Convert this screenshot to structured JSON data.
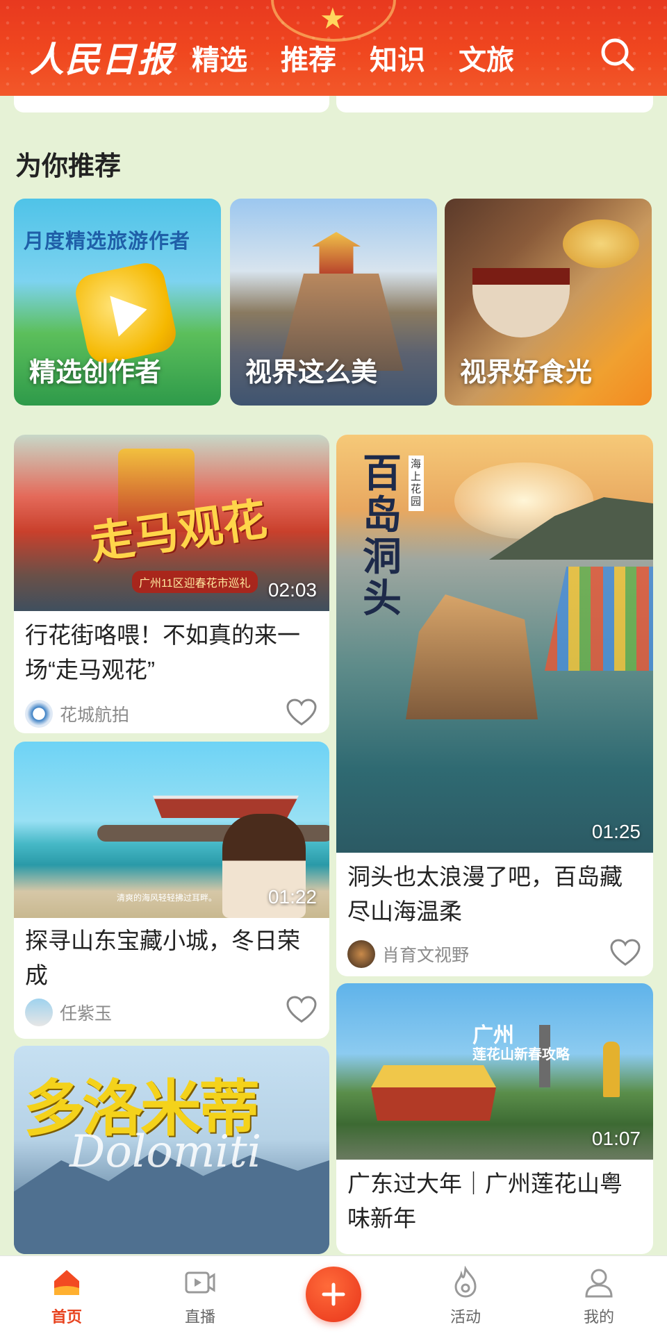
{
  "header": {
    "logo": "人民日报",
    "tabs": [
      "精选",
      "推荐",
      "知识",
      "文旅"
    ]
  },
  "section": {
    "title": "为你推荐"
  },
  "categories": [
    {
      "label": "精选创作者",
      "banner": "月度精选旅游作者"
    },
    {
      "label": "视界这么美"
    },
    {
      "label": "视界好食光"
    }
  ],
  "videos": [
    {
      "title": "行花街咯喂！不如真的来一场“走马观花”",
      "author": "花城航拍",
      "duration": "02:03",
      "overlay": "走马观花",
      "overlay_sub": "广州11区迎春花市巡礼"
    },
    {
      "title": "洞头也太浪漫了吧，百岛藏尽山海温柔",
      "author": "肖育文视野",
      "duration": "01:25",
      "overlay": "百岛洞头",
      "overlay_sub": "海上花园"
    },
    {
      "title": "探寻山东宝藏小城，冬日荣成",
      "author": "任紫玉",
      "duration": "01:22",
      "caption": "清爽的海风轻轻拂过耳畔。"
    },
    {
      "overlay": "多洛米蒂",
      "overlay_sub": "Dolomiti"
    },
    {
      "title": "广东过大年｜广州莲花山粤味新年",
      "duration": "01:07",
      "overlay": "广州",
      "overlay_sub": "莲花山新春攻略"
    }
  ],
  "tabbar": {
    "home": "首页",
    "live": "直播",
    "activity": "活动",
    "mine": "我的"
  },
  "colors": {
    "brand": "#e8431f",
    "background": "#e6f2d6"
  }
}
